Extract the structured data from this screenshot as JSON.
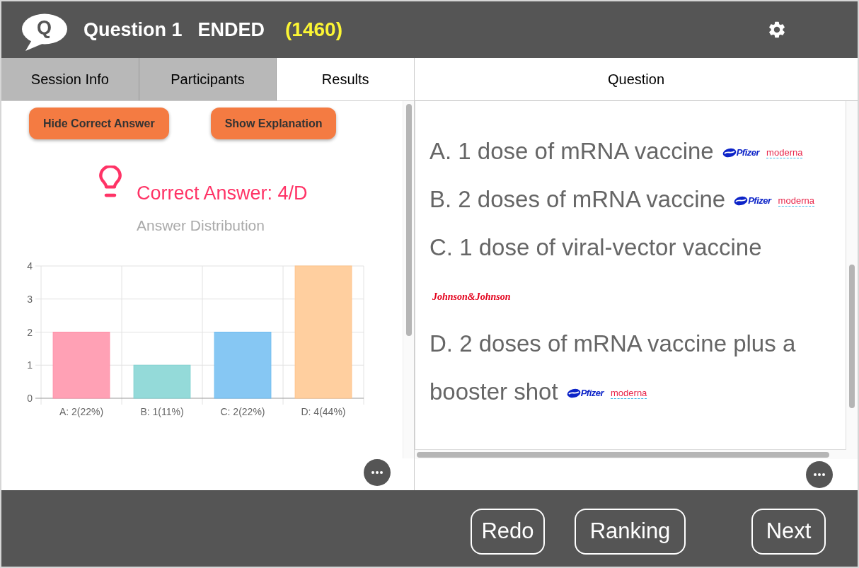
{
  "header": {
    "logo_letter": "Q",
    "title": "Question 1",
    "status": "ENDED",
    "code": "(1460)"
  },
  "tabs": [
    {
      "label": "Session Info",
      "selected": false
    },
    {
      "label": "Participants",
      "selected": false
    },
    {
      "label": "Results",
      "selected": true
    }
  ],
  "results": {
    "buttons": [
      "Hide Correct Answer",
      "Show Explanation"
    ],
    "correct_answer": "Correct Answer: 4/D",
    "chart_data": {
      "type": "bar",
      "title": "Answer Distribution",
      "categories": [
        "A: 2(22%)",
        "B: 1(11%)",
        "C: 2(22%)",
        "D: 4(44%)"
      ],
      "values": [
        2,
        1,
        2,
        4
      ],
      "ylim": [
        0,
        4
      ],
      "yticks": [
        0,
        1,
        2,
        3,
        4
      ],
      "grid": true
    }
  },
  "question": {
    "title": "Question",
    "options": [
      {
        "lines": [
          "A. 1 dose of mRNA vaccine"
        ],
        "logos": [
          {
            "kind": "pfizer",
            "text": "Pfizer"
          },
          {
            "kind": "moderna",
            "text": "moderna"
          }
        ]
      },
      {
        "lines": [
          "B. 2 doses of mRNA vaccine"
        ],
        "logos": [
          {
            "kind": "pfizer",
            "text": "Pfizer"
          },
          {
            "kind": "moderna",
            "text": "moderna"
          }
        ]
      },
      {
        "lines": [
          "C. 1 dose of viral-vector vaccine"
        ],
        "logos": [
          {
            "kind": "jnj",
            "text": "Johnson&Johnson"
          }
        ]
      },
      {
        "lines": [
          "D. 2 doses of mRNA vaccine plus a",
          "booster shot"
        ],
        "logos": [
          {
            "kind": "pfizer",
            "text": "Pfizer"
          },
          {
            "kind": "moderna",
            "text": "moderna"
          }
        ]
      }
    ]
  },
  "footer": {
    "buttons": [
      "Redo",
      "Ranking",
      "Next"
    ]
  }
}
